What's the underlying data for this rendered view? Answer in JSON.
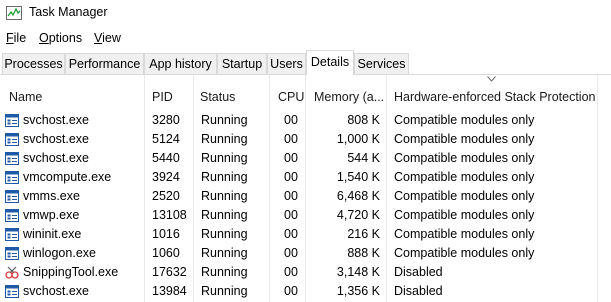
{
  "window": {
    "title": "Task Manager"
  },
  "menu": [
    {
      "label": "File",
      "underline": "F",
      "rest": "ile"
    },
    {
      "label": "Options",
      "underline": "O",
      "rest": "ptions"
    },
    {
      "label": "View",
      "underline": "V",
      "rest": "iew"
    }
  ],
  "tabs": [
    {
      "label": "Processes",
      "active": false
    },
    {
      "label": "Performance",
      "active": false
    },
    {
      "label": "App history",
      "active": false
    },
    {
      "label": "Startup",
      "active": false
    },
    {
      "label": "Users",
      "active": false
    },
    {
      "label": "Details",
      "active": true
    },
    {
      "label": "Services",
      "active": false
    }
  ],
  "columns": {
    "name": "Name",
    "pid": "PID",
    "status": "Status",
    "cpu": "CPU",
    "memory": "Memory (a...",
    "stack": "Hardware-enforced Stack Protection"
  },
  "sorted_column": "stack",
  "rows": [
    {
      "name": "svchost.exe",
      "icon": "service-host-icon",
      "pid": "3280",
      "status": "Running",
      "cpu": "00",
      "memory": "808 K",
      "stack": "Compatible modules only"
    },
    {
      "name": "svchost.exe",
      "icon": "service-host-icon",
      "pid": "5124",
      "status": "Running",
      "cpu": "00",
      "memory": "1,000 K",
      "stack": "Compatible modules only"
    },
    {
      "name": "svchost.exe",
      "icon": "service-host-icon",
      "pid": "5440",
      "status": "Running",
      "cpu": "00",
      "memory": "544 K",
      "stack": "Compatible modules only"
    },
    {
      "name": "vmcompute.exe",
      "icon": "service-host-icon",
      "pid": "3924",
      "status": "Running",
      "cpu": "00",
      "memory": "1,540 K",
      "stack": "Compatible modules only"
    },
    {
      "name": "vmms.exe",
      "icon": "service-host-icon",
      "pid": "2520",
      "status": "Running",
      "cpu": "00",
      "memory": "6,468 K",
      "stack": "Compatible modules only"
    },
    {
      "name": "vmwp.exe",
      "icon": "service-host-icon",
      "pid": "13108",
      "status": "Running",
      "cpu": "00",
      "memory": "4,720 K",
      "stack": "Compatible modules only"
    },
    {
      "name": "wininit.exe",
      "icon": "service-host-icon",
      "pid": "1016",
      "status": "Running",
      "cpu": "00",
      "memory": "216 K",
      "stack": "Compatible modules only"
    },
    {
      "name": "winlogon.exe",
      "icon": "service-host-icon",
      "pid": "1060",
      "status": "Running",
      "cpu": "00",
      "memory": "888 K",
      "stack": "Compatible modules only"
    },
    {
      "name": "SnippingTool.exe",
      "icon": "snipping-tool-icon",
      "pid": "17632",
      "status": "Running",
      "cpu": "00",
      "memory": "3,148 K",
      "stack": "Disabled"
    },
    {
      "name": "svchost.exe",
      "icon": "service-host-icon",
      "pid": "13984",
      "status": "Running",
      "cpu": "00",
      "memory": "1,356 K",
      "stack": "Disabled"
    }
  ],
  "colors": {
    "tab_bg": "#f0f0f0",
    "tab_border": "#d9d9d9",
    "icon_blue": "#1e5aa8",
    "snip_red": "#d83b3b"
  }
}
